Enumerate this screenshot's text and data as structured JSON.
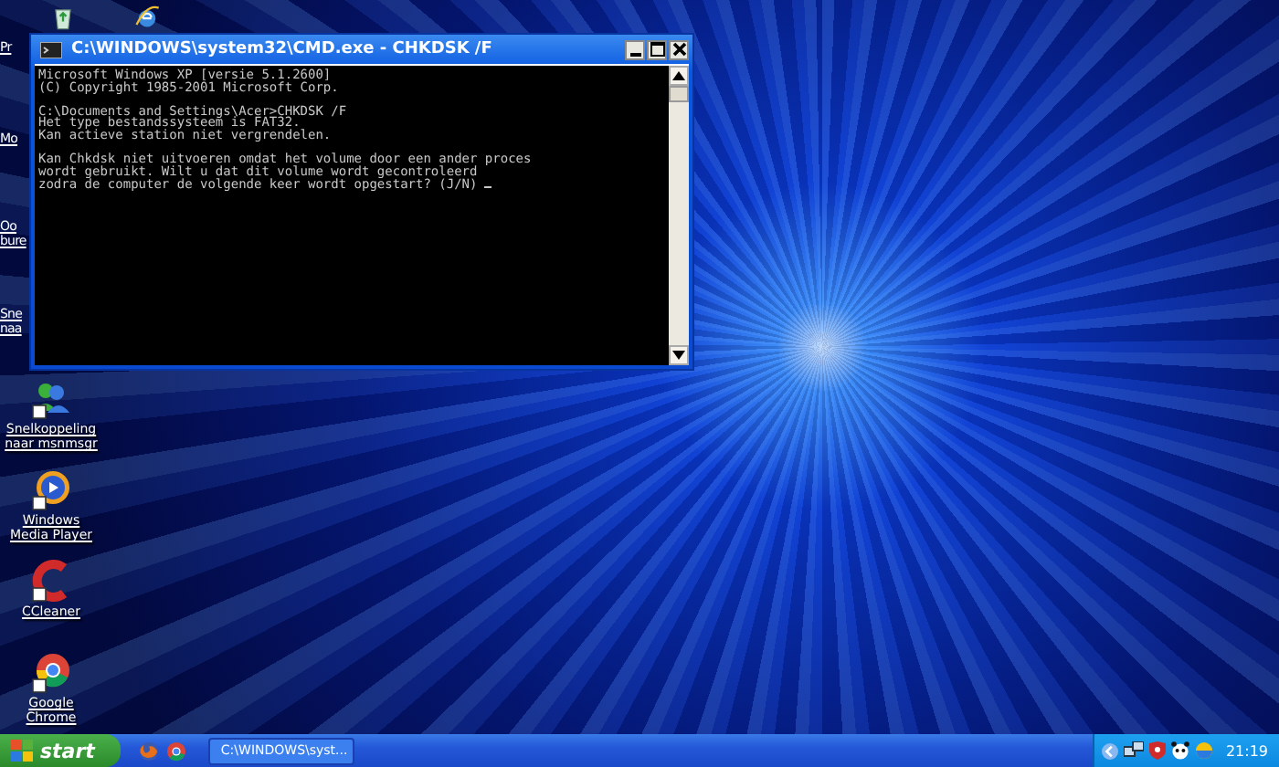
{
  "desktop": {
    "icons": [
      {
        "kind": "recycle"
      },
      {
        "kind": "ie"
      },
      {
        "kind": "partial",
        "lines": [
          "Pr"
        ]
      },
      {
        "kind": "partial",
        "lines": [
          "Mo"
        ]
      },
      {
        "kind": "partial",
        "lines": [
          "Oo",
          "bure"
        ]
      },
      {
        "kind": "partial",
        "lines": [
          "Sne",
          "naa"
        ]
      },
      {
        "kind": "msn",
        "lines": [
          "Snelkoppeling",
          "naar msnmsgr"
        ]
      },
      {
        "kind": "wmp",
        "lines": [
          "Windows",
          "Media Player"
        ]
      },
      {
        "kind": "ccleaner",
        "lines": [
          "CCleaner"
        ]
      },
      {
        "kind": "chrome",
        "lines": [
          "Google",
          "Chrome"
        ]
      }
    ]
  },
  "window": {
    "title": "C:\\WINDOWS\\system32\\CMD.exe - CHKDSK /F",
    "cursor": true,
    "paragraphs": [
      [
        "Microsoft Windows XP [versie 5.1.2600]",
        "(C) Copyright 1985-2001 Microsoft Corp."
      ],
      [
        "C:\\Documents and Settings\\Acer>CHKDSK /F",
        "Het type bestandssysteem is FAT32.",
        "Kan actieve station niet vergrendelen."
      ],
      [
        "Kan Chkdsk niet uitvoeren omdat het volume door een ander proces",
        "wordt gebruikt. Wilt u dat dit volume wordt gecontroleerd",
        "zodra de computer de volgende keer wordt opgestart? (J/N)"
      ]
    ]
  },
  "taskbar": {
    "start": "start",
    "quick_launch": [
      {
        "kind": "firefox"
      },
      {
        "kind": "chrome"
      }
    ],
    "tasks": [
      {
        "label": "C:\\WINDOWS\\syst..."
      }
    ],
    "clock": "21:19"
  }
}
